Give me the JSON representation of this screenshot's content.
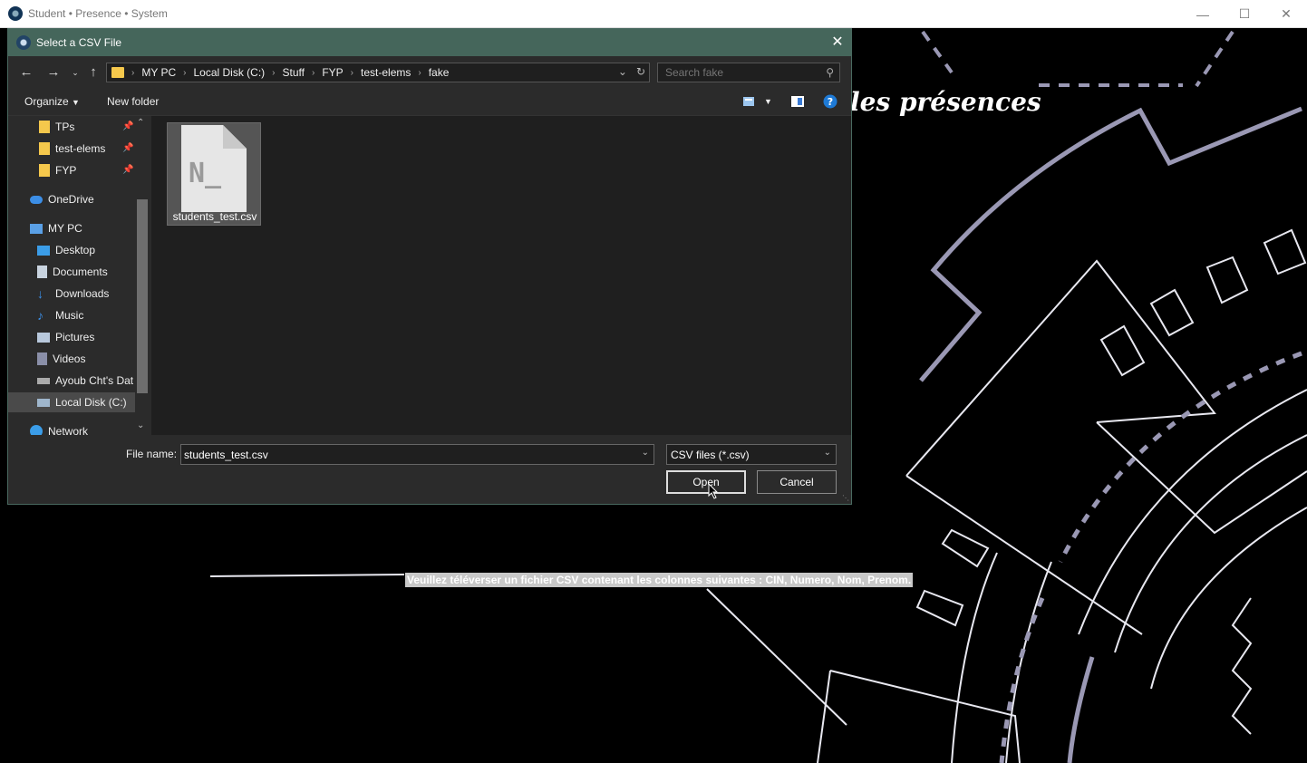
{
  "app": {
    "title": "Student • Presence • System"
  },
  "background": {
    "heading": "les présences",
    "note": "Veuillez téléverser un fichier CSV contenant les colonnes suivantes : CIN, Numero, Nom, Prenom."
  },
  "dialog": {
    "title": "Select a CSV File",
    "breadcrumb": [
      "MY PC",
      "Local Disk (C:)",
      "Stuff",
      "FYP",
      "test-elems",
      "fake"
    ],
    "search_placeholder": "Search fake",
    "toolbar": {
      "organize": "Organize",
      "new_folder": "New folder"
    },
    "nav": {
      "quick": [
        {
          "label": "TPs"
        },
        {
          "label": "test-elems"
        },
        {
          "label": "FYP"
        }
      ],
      "onedrive": "OneDrive",
      "mypc": "MY PC",
      "pc_items": [
        "Desktop",
        "Documents",
        "Downloads",
        "Music",
        "Pictures",
        "Videos",
        "Ayoub Cht's Dat",
        "Local Disk (C:)"
      ],
      "network": "Network"
    },
    "files": [
      {
        "name": "students_test.csv",
        "glyph": "N_"
      }
    ],
    "file_name_label": "File name:",
    "file_name_value": "students_test.csv",
    "file_type": "CSV files (*.csv)",
    "open_label": "Open",
    "cancel_label": "Cancel"
  },
  "colors": {
    "dialog_titlebar": "#45665b",
    "art_stroke": "#9a98b4"
  }
}
